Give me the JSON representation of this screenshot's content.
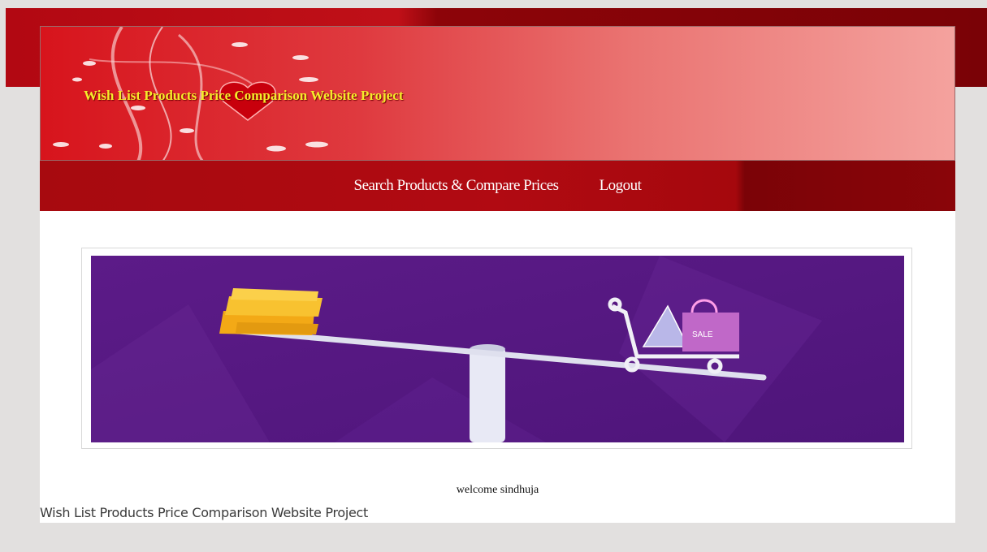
{
  "header": {
    "site_title": "Wish List Products Price Comparison Website Project"
  },
  "nav": {
    "items": [
      {
        "label": "Search Products & Compare Prices"
      },
      {
        "label": "Logout"
      }
    ]
  },
  "banner": {
    "colors": {
      "background": "#5b1a87",
      "coins": "#f5b81c",
      "beam": "#e6e6ef"
    },
    "tag_text": "SALE"
  },
  "welcome_text": "welcome sindhuja",
  "footer": {
    "text": "Wish List Products Price Comparison Website Project"
  }
}
